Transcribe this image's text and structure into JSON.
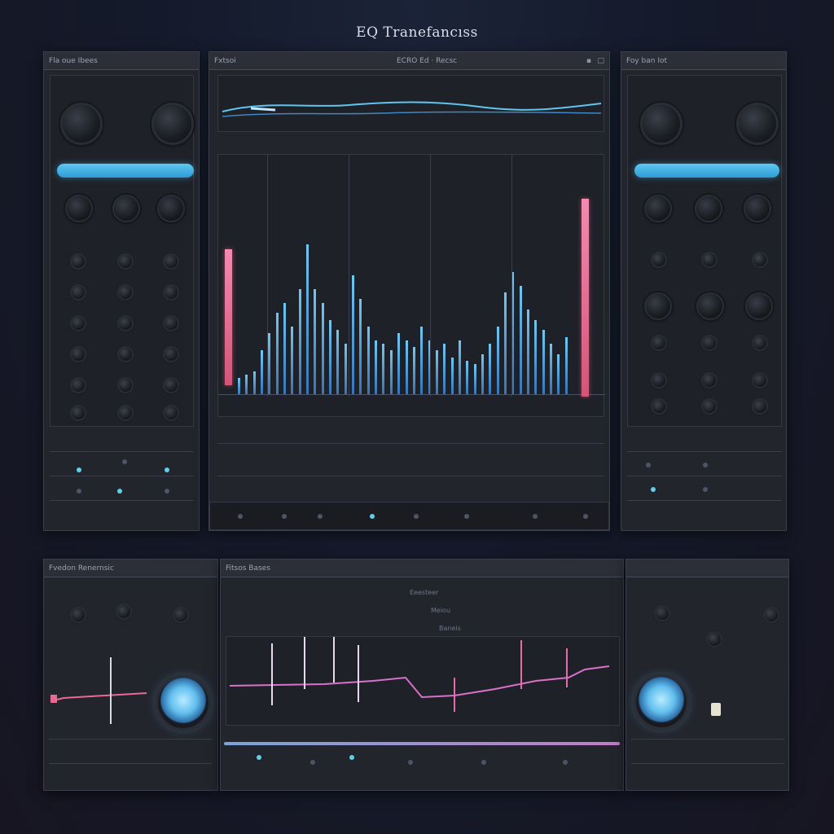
{
  "app": {
    "title": "EQ Tranefancıss"
  },
  "panels": {
    "left_top": {
      "title": "Fla oue Ibees"
    },
    "center_top": {
      "title": "Fxtsoi",
      "subtitle": "ECRO  Ed  ·  Recsc"
    },
    "right_top": {
      "title": "Foy ban  Iot"
    },
    "left_bottom": {
      "title": "Fvedon  Renernsic"
    },
    "center_bottom": {
      "title": "Fitsos Bases",
      "label_a": "Eeesteer",
      "label_b": "Meiou",
      "label_c": "Baneis"
    },
    "right_bottom": {
      "title": ""
    }
  },
  "colors": {
    "accent_blue": "#3aa8e0",
    "accent_pink": "#e86a92",
    "panel_bg": "#23252d"
  },
  "chart_data": {
    "type": "bar",
    "bars": [
      10,
      12,
      14,
      26,
      36,
      48,
      54,
      40,
      62,
      88,
      62,
      54,
      44,
      38,
      30,
      70,
      56,
      40,
      32,
      30,
      26,
      36,
      32,
      28,
      40,
      32,
      26,
      30,
      22,
      32,
      20,
      18,
      24,
      30,
      40,
      60,
      72,
      64,
      50,
      44,
      38,
      30,
      24,
      34
    ],
    "ylim": [
      0,
      100
    ],
    "meters": [
      62,
      90
    ]
  }
}
